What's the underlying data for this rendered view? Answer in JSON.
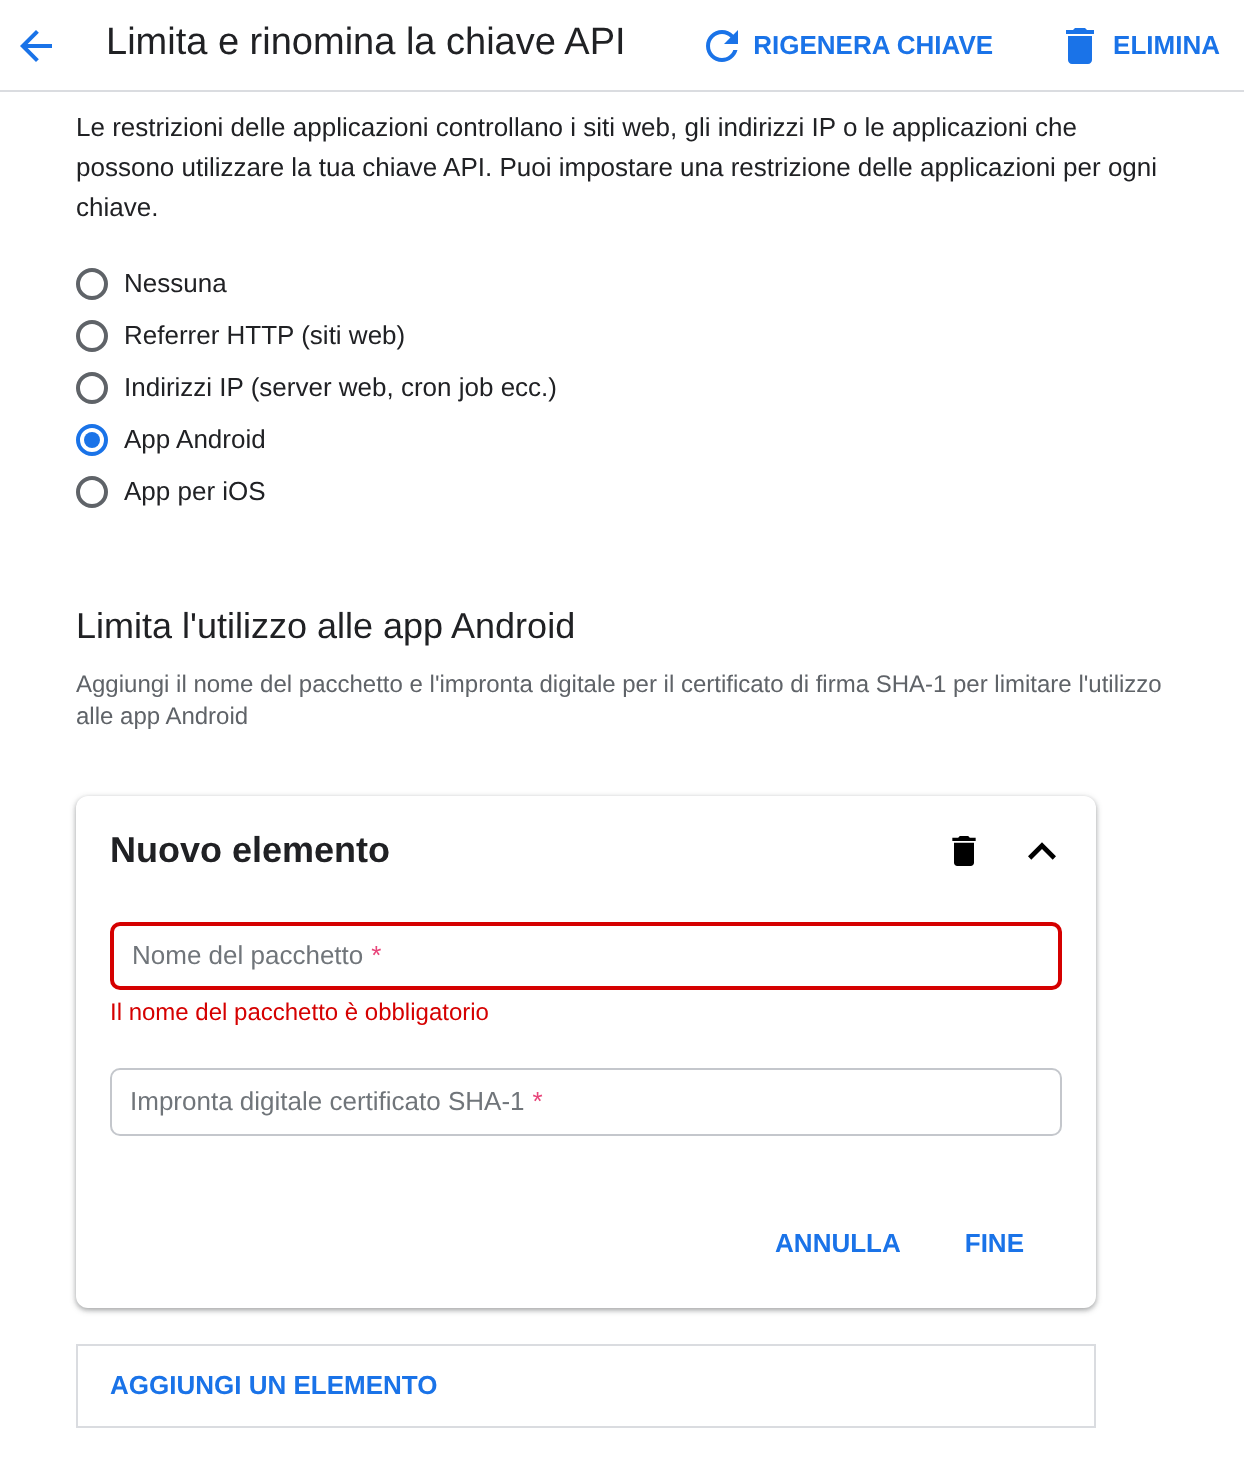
{
  "header": {
    "title": "Limita e rinomina la chiave API",
    "actions": [
      {
        "kind": "regenerate",
        "label": "RIGENERA CHIAVE"
      },
      {
        "kind": "delete",
        "label": "ELIMINA"
      }
    ]
  },
  "description": "Le restrizioni delle applicazioni controllano i siti web, gli indirizzi IP o le applicazioni che possono utilizzare la tua chiave API. Puoi impostare una restrizione delle applicazioni per ogni chiave.",
  "restriction_options": [
    {
      "label": "Nessuna",
      "selected": false
    },
    {
      "label": "Referrer HTTP (siti web)",
      "selected": false
    },
    {
      "label": "Indirizzi IP (server web, cron job ecc.)",
      "selected": false
    },
    {
      "label": "App Android",
      "selected": true
    },
    {
      "label": "App per iOS",
      "selected": false
    }
  ],
  "android_section": {
    "heading": "Limita l'utilizzo alle app Android",
    "description": "Aggiungi il nome del pacchetto e l'impronta digitale per il certificato di firma SHA-1 per limitare l'utilizzo alle app Android",
    "items": [
      {
        "title": "Nuovo elemento",
        "expanded": true,
        "fields": [
          {
            "placeholder": "Nome del pacchetto",
            "required_mark": "*",
            "invalid": true,
            "error": "Il nome del pacchetto è obbligatorio"
          },
          {
            "placeholder": "Impronta digitale certificato SHA-1",
            "required_mark": "*",
            "invalid": false
          }
        ],
        "buttons": [
          "ANNULLA",
          "FINE"
        ]
      }
    ],
    "add_button": "AGGIUNGI UN ELEMENTO"
  }
}
